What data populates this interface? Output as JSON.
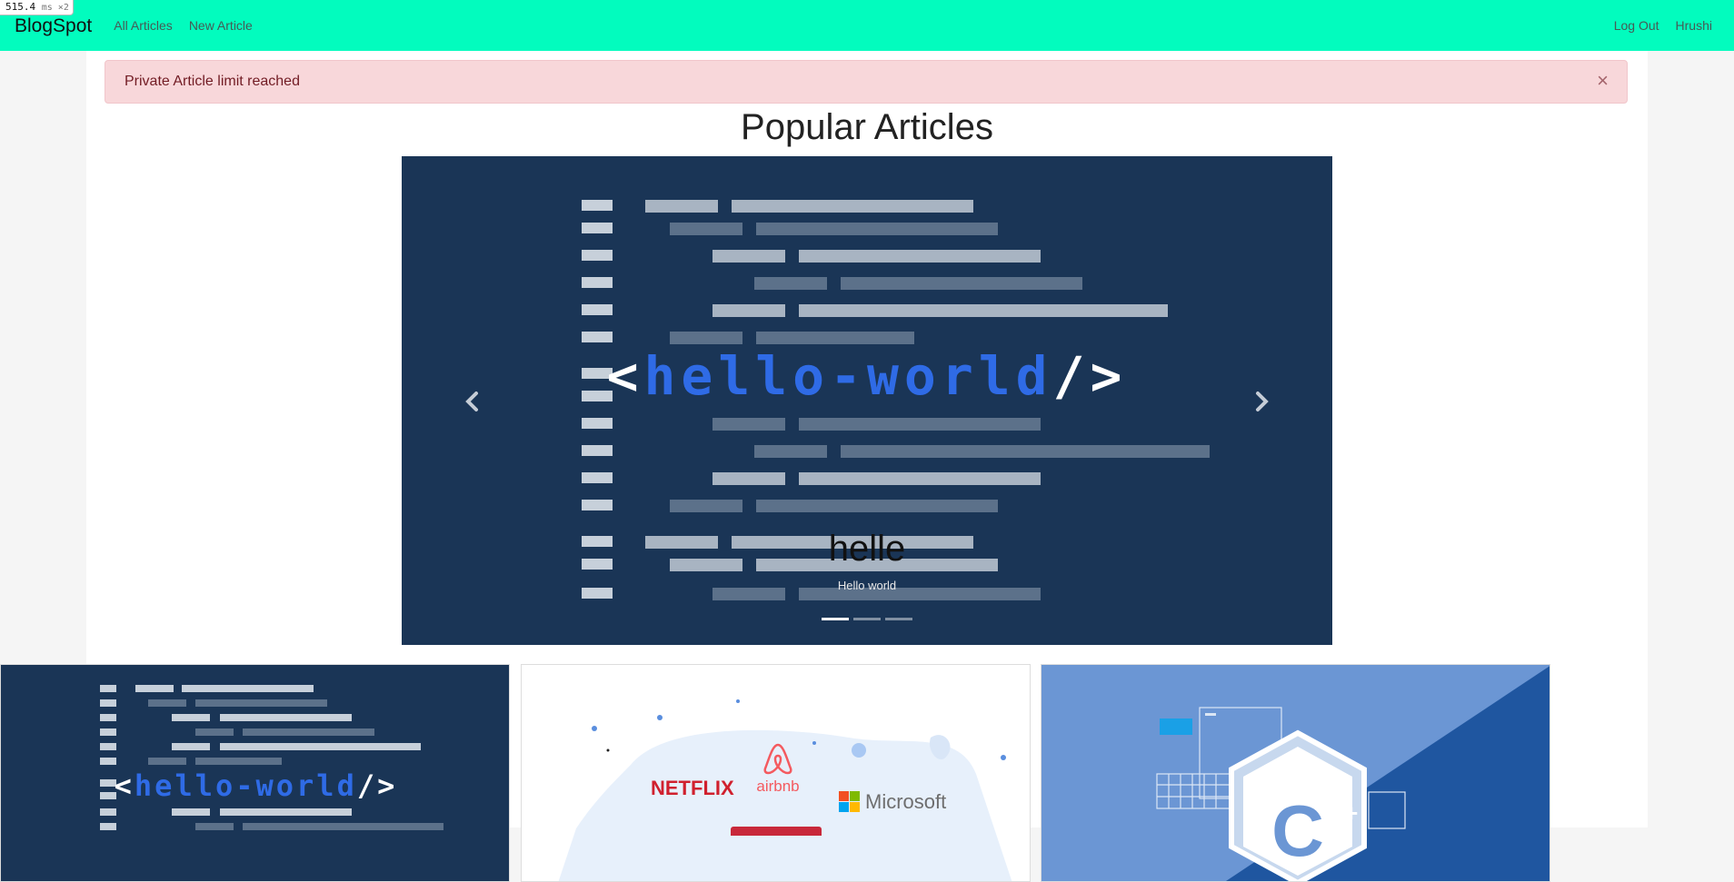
{
  "perf": {
    "value": "515.4",
    "unit": "ms ×2"
  },
  "navbar": {
    "brand": "BlogSpot",
    "links": [
      "All Articles",
      "New Article"
    ],
    "right": [
      "Log Out",
      "Hrushi"
    ],
    "background": "#02fcbe"
  },
  "alert": {
    "message": "Private Article limit reached",
    "close": "×"
  },
  "page": {
    "title": "Popular Articles"
  },
  "carousel": {
    "slide_text_left": "<",
    "slide_text_word": "hello-world",
    "slide_text_right": "/>",
    "caption_title": "helle",
    "caption_subtitle": "Hello world",
    "prev_icon": "chevron-left-icon",
    "next_icon": "chevron-right-icon",
    "slide_count": 3,
    "active_slide": 1
  },
  "cards": [
    {
      "image": "hello-world-code-image",
      "hero_left": "<",
      "hero_word": "hello-world",
      "hero_right": "/>"
    },
    {
      "image": "companies-logos-image",
      "logos": [
        "NETFLIX",
        "airbnb",
        "Microsoft"
      ]
    },
    {
      "image": "cpp-logo-image",
      "logo_text": "++"
    }
  ],
  "colors": {
    "accent": "#02fcbe",
    "alert_bg": "#f8d7da",
    "alert_text": "#721c24",
    "hero_blue": "#2f6be6",
    "slide_bg": "#1a3556"
  }
}
